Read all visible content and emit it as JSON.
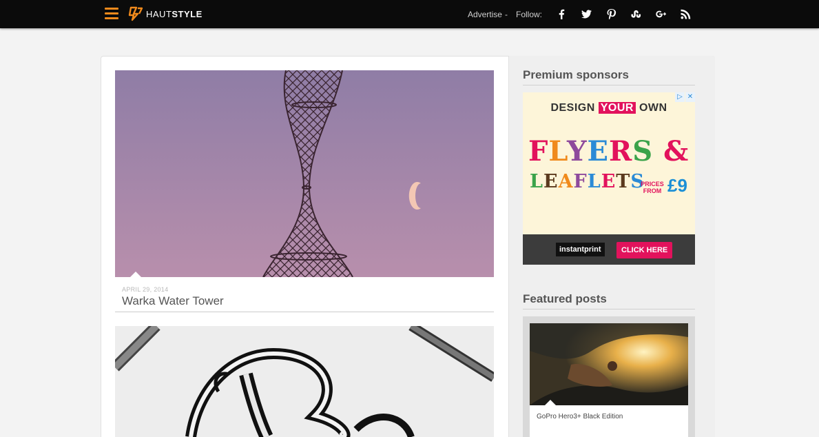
{
  "header": {
    "logo_text_light": "HAUT",
    "logo_text_bold": "STYLE",
    "advertise": "Advertise",
    "separator": "-",
    "follow": "Follow:",
    "social_icons": [
      "facebook-icon",
      "twitter-icon",
      "pinterest-icon",
      "stumbleupon-icon",
      "google-plus-icon",
      "rss-icon"
    ],
    "accent_color": "#f08a1c"
  },
  "posts": [
    {
      "date": "APRIL 29, 2014",
      "title": "Warka Water Tower"
    }
  ],
  "sidebar": {
    "sponsors_heading": "Premium sponsors",
    "featured_heading": "Featured posts",
    "ad": {
      "design": "DESIGN",
      "your": "YOUR",
      "own": "OWN",
      "flyers": "FLYERS &",
      "leaflets": "LEAFLETS",
      "prices_from": "PRICES FROM",
      "price": "£9",
      "brand": "instantprint",
      "cta": "CLICK HERE",
      "adchoices_icon": "▷",
      "close_icon": "✕"
    },
    "featured": [
      {
        "title": "GoPro Hero3+ Black Edition"
      }
    ]
  }
}
